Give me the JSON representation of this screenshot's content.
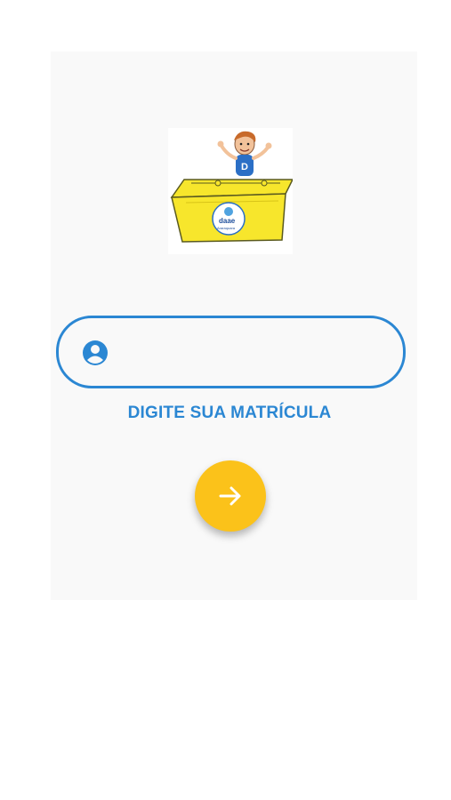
{
  "screen": {
    "logo": {
      "icon": "dumpster-mascot-logo",
      "brand_text": "daae",
      "brand_subtext": "Araraquara"
    },
    "registration_input": {
      "value": "",
      "placeholder": "",
      "icon": "account-circle-icon"
    },
    "hint_label": "DIGITE SUA MATRÍCULA",
    "submit_button": {
      "icon": "arrow-right-icon"
    }
  },
  "colors": {
    "accent_blue": "#2b87d3",
    "fab_yellow": "#fbc21a",
    "card_background": "#f9f9f9",
    "dumpster_yellow": "#f7e62c"
  }
}
